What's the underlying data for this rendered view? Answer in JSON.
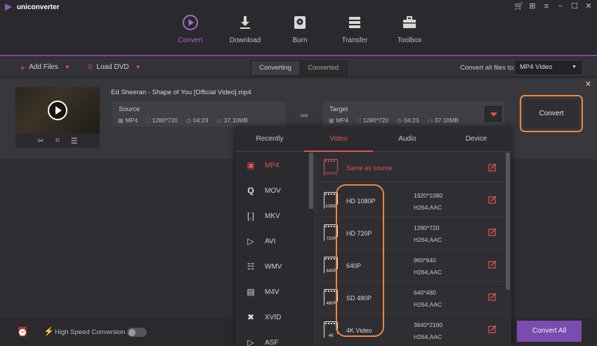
{
  "app": {
    "name": "uniconverter"
  },
  "nav": [
    {
      "label": "Convert",
      "icon": "convert-icon",
      "active": true
    },
    {
      "label": "Download",
      "icon": "download-icon",
      "active": false
    },
    {
      "label": "Burn",
      "icon": "burn-icon",
      "active": false
    },
    {
      "label": "Transfer",
      "icon": "transfer-icon",
      "active": false
    },
    {
      "label": "Toolbox",
      "icon": "toolbox-icon",
      "active": false
    }
  ],
  "toolbar": {
    "add_files": "Add Files",
    "load_dvd": "Load DVD",
    "tab_converting": "Converting",
    "tab_converted": "Converted",
    "convert_all_to_label": "Convert all files to:",
    "convert_all_to_value": "MP4 Video"
  },
  "media": {
    "title": "Ed Sheeran - Shape of You [Official Video].mp4",
    "source": {
      "label": "Source",
      "format": "MP4",
      "resolution": "1280*720",
      "duration": "04:23",
      "size": "37.10MB"
    },
    "target": {
      "label": "Target",
      "format": "MP4",
      "resolution": "1280*720",
      "duration": "04:23",
      "size": "37.10MB"
    },
    "convert_button": "Convert"
  },
  "popup": {
    "tabs": [
      "Recently",
      "Video",
      "Audio",
      "Device"
    ],
    "active_tab": "Video",
    "formats": [
      "MP4",
      "MOV",
      "MKV",
      "AVI",
      "WMV",
      "M4V",
      "XVID",
      "ASF"
    ],
    "active_format": "MP4",
    "same_as_source": {
      "label": "Same as source",
      "tag": "source"
    },
    "presets": [
      {
        "name": "HD 1080P",
        "tag": "1080P",
        "resolution": "1920*1080",
        "codec": "H264,AAC"
      },
      {
        "name": "HD 720P",
        "tag": "720P",
        "resolution": "1280*720",
        "codec": "H264,AAC"
      },
      {
        "name": "640P",
        "tag": "640P",
        "resolution": "960*640",
        "codec": "H264,AAC"
      },
      {
        "name": "SD 480P",
        "tag": "480P",
        "resolution": "640*480",
        "codec": "H264,AAC"
      },
      {
        "name": "4K Video",
        "tag": "4K",
        "resolution": "3840*2160",
        "codec": "H264,AAC"
      }
    ]
  },
  "footer": {
    "high_speed_label": "High Speed Conversion",
    "high_speed_on": false,
    "convert_all_button": "Convert All"
  },
  "colors": {
    "accent_purple": "#7b4bb0",
    "accent_red": "#e0554f",
    "highlight_orange": "#ee8a3b"
  }
}
